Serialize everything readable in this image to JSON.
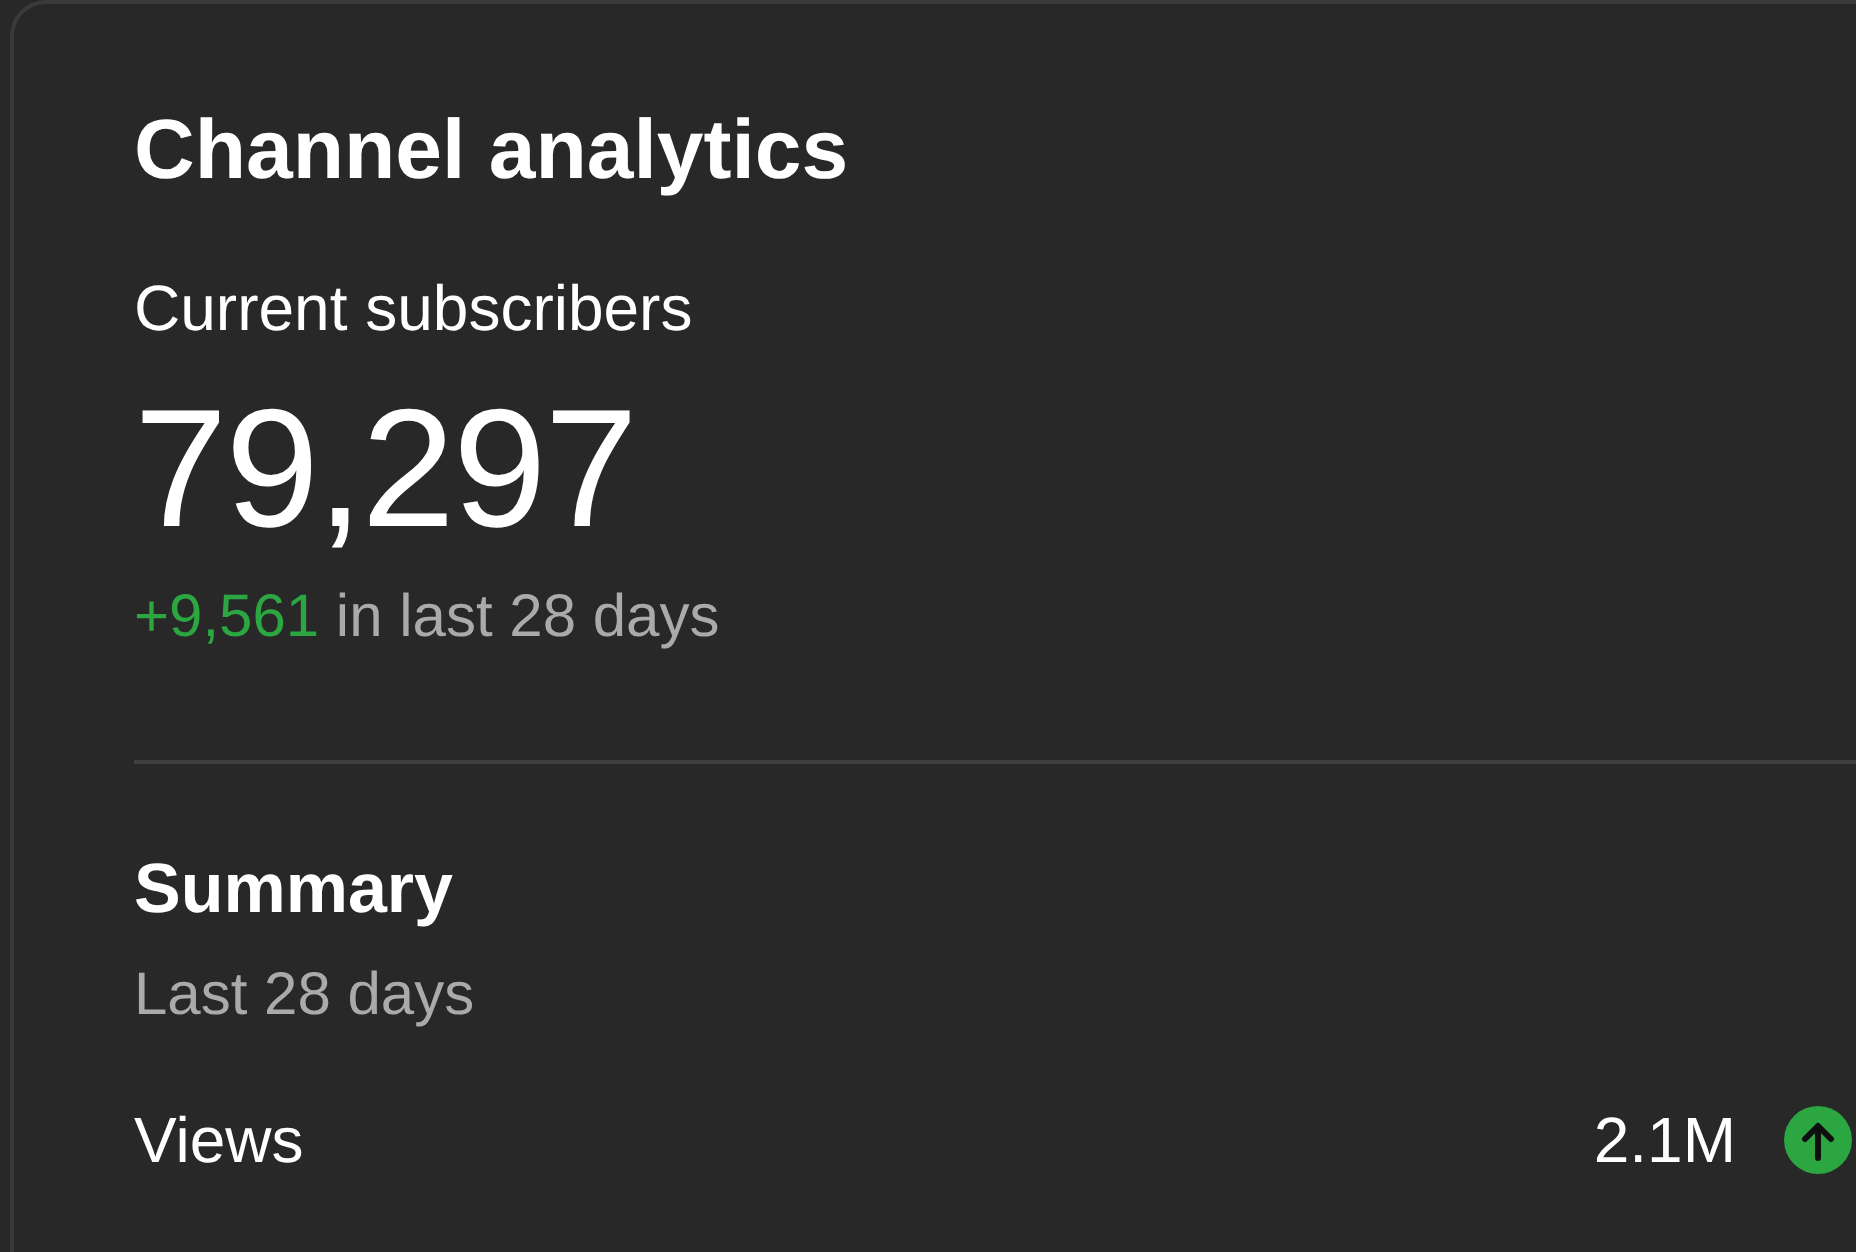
{
  "card": {
    "title": "Channel analytics",
    "subscribers": {
      "label": "Current subscribers",
      "value": "79,297",
      "change": "+9,561",
      "change_period": "in last 28 days"
    },
    "summary": {
      "title": "Summary",
      "period": "Last 28 days",
      "metrics": [
        {
          "label": "Views",
          "value": "2.1M",
          "trend_up": true
        }
      ]
    }
  }
}
